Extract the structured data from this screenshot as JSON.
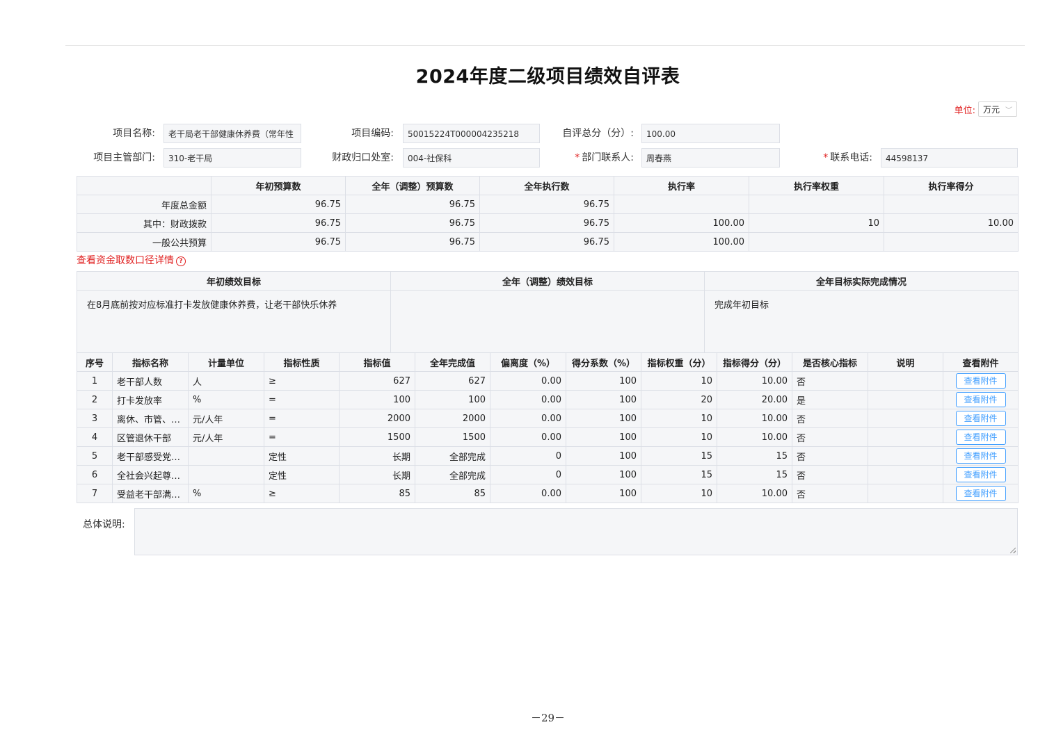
{
  "title": "2024年度二级项目绩效自评表",
  "unit": {
    "label": "单位:",
    "value": "万元"
  },
  "fields": {
    "project_name": {
      "label": "项目名称:",
      "value": "老干局老干部健康休养费（常年性"
    },
    "project_code": {
      "label": "项目编码:",
      "value": "50015224T000004235218"
    },
    "total_score": {
      "label": "自评总分（分）:",
      "value": "100.00"
    },
    "department": {
      "label": "项目主管部门:",
      "value": "310-老干局"
    },
    "finance_office": {
      "label": "财政归口处室:",
      "value": "004-社保科"
    },
    "contact_person": {
      "label": "部门联系人:",
      "value": "周春燕"
    },
    "contact_phone": {
      "label": "联系电话:",
      "value": "44598137"
    }
  },
  "budget_table": {
    "headers": [
      "年初预算数",
      "全年（调整）预算数",
      "全年执行数",
      "执行率",
      "执行率权重",
      "执行率得分"
    ],
    "rows": [
      {
        "label": "年度总金额",
        "cells": [
          "96.75",
          "96.75",
          "96.75",
          "",
          "",
          ""
        ]
      },
      {
        "label": "其中：财政拨款",
        "cells": [
          "96.75",
          "96.75",
          "96.75",
          "100.00",
          "10",
          "10.00"
        ]
      },
      {
        "label": "一般公共预算",
        "cells": [
          "96.75",
          "96.75",
          "96.75",
          "100.00",
          "",
          ""
        ]
      }
    ]
  },
  "detail_link": {
    "text": "查看资金取数口径详情",
    "icon": "?"
  },
  "goals_table": {
    "headers": [
      "年初绩效目标",
      "全年（调整）绩效目标",
      "全年目标实际完成情况"
    ],
    "values": [
      "在8月底前按对应标准打卡发放健康休养费，让老干部快乐休养",
      "",
      "完成年初目标"
    ]
  },
  "indicator_table": {
    "headers": [
      "序号",
      "指标名称",
      "计量单位",
      "指标性质",
      "指标值",
      "全年完成值",
      "偏离度（%）",
      "得分系数（%）",
      "指标权重（分）",
      "指标得分（分）",
      "是否核心指标",
      "说明",
      "查看附件"
    ],
    "button_label": "查看附件",
    "rows": [
      {
        "no": "1",
        "name": "老干部人数",
        "unit": "人",
        "nature": "≥",
        "target": "627",
        "actual": "627",
        "deviation": "0.00",
        "coef": "100",
        "weight": "10",
        "score": "10.00",
        "core": "否",
        "note": ""
      },
      {
        "no": "2",
        "name": "打卡发放率",
        "unit": "%",
        "nature": "=",
        "target": "100",
        "actual": "100",
        "deviation": "0.00",
        "coef": "100",
        "weight": "20",
        "score": "20.00",
        "core": "是",
        "note": ""
      },
      {
        "no": "3",
        "name": "离休、市管、…",
        "unit": "元/人年",
        "nature": "=",
        "target": "2000",
        "actual": "2000",
        "deviation": "0.00",
        "coef": "100",
        "weight": "10",
        "score": "10.00",
        "core": "否",
        "note": ""
      },
      {
        "no": "4",
        "name": "区管退休干部",
        "unit": "元/人年",
        "nature": "=",
        "target": "1500",
        "actual": "1500",
        "deviation": "0.00",
        "coef": "100",
        "weight": "10",
        "score": "10.00",
        "core": "否",
        "note": ""
      },
      {
        "no": "5",
        "name": "老干部感受党…",
        "unit": "",
        "nature": "定性",
        "target": "长期",
        "actual": "全部完成",
        "deviation": "0",
        "coef": "100",
        "weight": "15",
        "score": "15",
        "core": "否",
        "note": ""
      },
      {
        "no": "6",
        "name": "全社会兴起尊…",
        "unit": "",
        "nature": "定性",
        "target": "长期",
        "actual": "全部完成",
        "deviation": "0",
        "coef": "100",
        "weight": "15",
        "score": "15",
        "core": "否",
        "note": ""
      },
      {
        "no": "7",
        "name": "受益老干部满…",
        "unit": "%",
        "nature": "≥",
        "target": "85",
        "actual": "85",
        "deviation": "0.00",
        "coef": "100",
        "weight": "10",
        "score": "10.00",
        "core": "否",
        "note": ""
      }
    ]
  },
  "summary": {
    "label": "总体说明:",
    "value": ""
  },
  "page_number": "－29－"
}
